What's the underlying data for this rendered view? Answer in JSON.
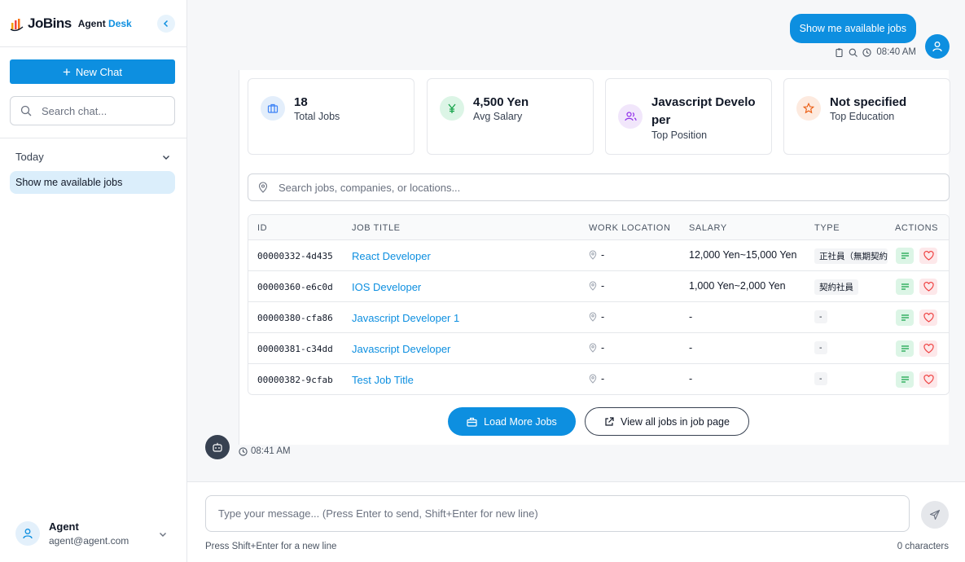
{
  "brand": {
    "logo_text": "JoBins",
    "sub_main": "Agent",
    "sub_accent": "Desk"
  },
  "sidebar": {
    "new_chat_label": "New Chat",
    "search_placeholder": "Search chat...",
    "group_label": "Today",
    "chat_items": [
      {
        "label": "Show me available jobs"
      }
    ]
  },
  "user": {
    "name": "Agent",
    "email": "agent@agent.com"
  },
  "conversation": {
    "user_message": "Show me available jobs",
    "user_time": "08:40 AM",
    "bot_time": "08:41 AM"
  },
  "stats": [
    {
      "value": "18",
      "label": "Total Jobs",
      "icon": "briefcase-icon",
      "color": "#e3eefb"
    },
    {
      "value": "4,500 Yen",
      "label": "Avg Salary",
      "icon": "yen-icon",
      "color": "#dcf5e6"
    },
    {
      "value": "Javascript Developer",
      "label": "Top Position",
      "icon": "users-icon",
      "color": "#f1e6fb"
    },
    {
      "value": "Not specified",
      "label": "Top Education",
      "icon": "star-icon",
      "color": "#fdeadf"
    }
  ],
  "job_search": {
    "placeholder": "Search jobs, companies, or locations..."
  },
  "table": {
    "headers": [
      "ID",
      "JOB TITLE",
      "WORK LOCATION",
      "SALARY",
      "TYPE",
      "ACTIONS"
    ],
    "rows": [
      {
        "id": "00000332-4d435",
        "title": "React Developer",
        "location": "-",
        "salary": "12,000 Yen~15,000 Yen",
        "type": "正社員（無期契約"
      },
      {
        "id": "00000360-e6c0d",
        "title": "IOS Developer",
        "location": "-",
        "salary": "1,000 Yen~2,000 Yen",
        "type": "契約社員"
      },
      {
        "id": "00000380-cfa86",
        "title": "Javascript Developer 1",
        "location": "-",
        "salary": "-",
        "type": "-"
      },
      {
        "id": "00000381-c34dd",
        "title": "Javascript Developer",
        "location": "-",
        "salary": "-",
        "type": "-"
      },
      {
        "id": "00000382-9cfab",
        "title": "Test Job Title",
        "location": "-",
        "salary": "-",
        "type": "-"
      }
    ]
  },
  "buttons": {
    "load_more": "Load More Jobs",
    "view_all": "View all jobs in job page"
  },
  "composer": {
    "placeholder": "Type your message... (Press Enter to send, Shift+Enter for new line)",
    "hint": "Press Shift+Enter for a new line",
    "counter": "0 characters"
  },
  "colors": {
    "accent": "#0d8fe0"
  }
}
